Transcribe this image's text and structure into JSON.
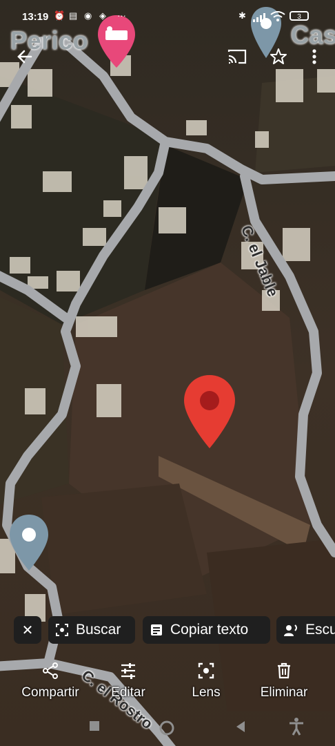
{
  "status_bar": {
    "time": "13:19",
    "battery": "3"
  },
  "map": {
    "top_left_label": "Perico",
    "top_right_label": "Cas",
    "streets": {
      "jable": "C. el Jable",
      "rostro": "C. el Rostro"
    }
  },
  "chips": {
    "close": "✕",
    "search": "Buscar",
    "copy_text": "Copiar texto",
    "listen": "Escu"
  },
  "actions": {
    "share": "Compartir",
    "edit": "Editar",
    "lens": "Lens",
    "delete": "Eliminar"
  },
  "colors": {
    "red_pin": "#e63c32",
    "hotel_pin": "#e8487a",
    "blue_pin": "#7d97a8",
    "chip_bg": "#1f1f1f"
  }
}
